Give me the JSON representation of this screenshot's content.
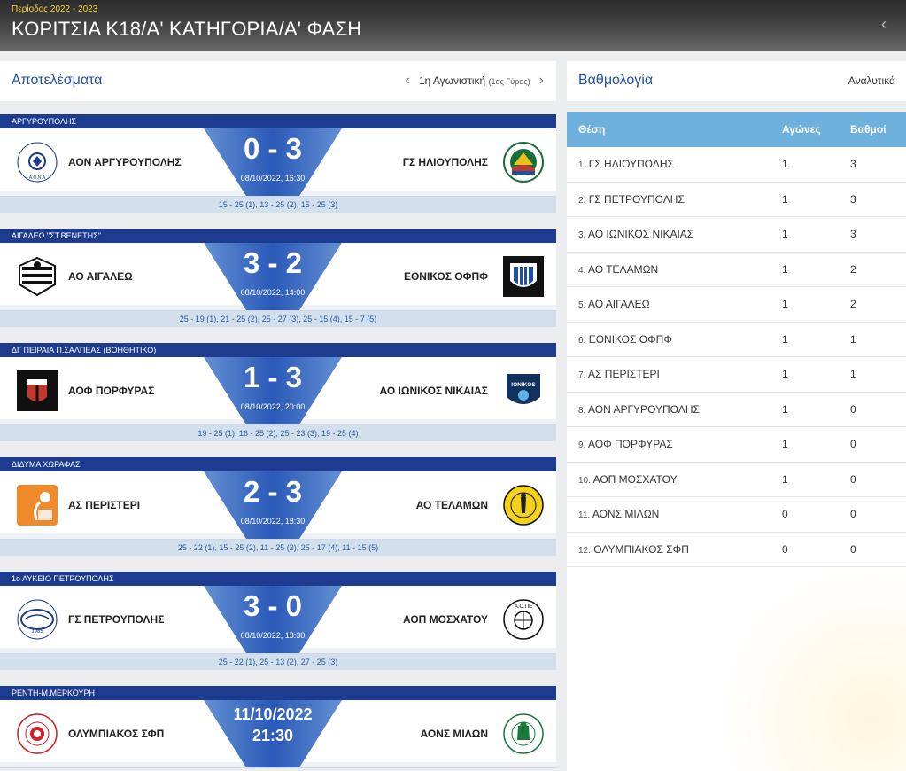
{
  "header": {
    "period": "Περίοδος 2022 - 2023",
    "title": "ΚΟΡΙΤΣΙΑ Κ18/Α' ΚΑΤΗΓΟΡΙΑ/Α' ΦΑΣΗ",
    "back_icon": "chevron-left-icon"
  },
  "results": {
    "title": "Αποτελέσματα",
    "round": "1η Αγωνιστική",
    "round_note": "(1ος Γύρος)",
    "matches": [
      {
        "venue": "ΑΡΓΥΡΟΥΠΟΛΗΣ",
        "home": "ΑΟΝ ΑΡΓΥΡΟΥΠΟΛΗΣ",
        "away": "ΓΣ ΗΛΙΟΥΠΟΛΗΣ",
        "score": "0 - 3",
        "date": "08/10/2022, 16:30",
        "sets": "15 - 25 (1), 13 - 25 (2), 15 - 25 (3)"
      },
      {
        "venue": "ΑΙΓΑΛΕΩ \"ΣΤ.ΒΕΝΕΤΗΣ\"",
        "home": "ΑΟ ΑΙΓΑΛΕΩ",
        "away": "ΕΘΝΙΚΟΣ ΟΦΠΦ",
        "score": "3 - 2",
        "date": "08/10/2022, 14:00",
        "sets": "25 - 19 (1), 21 - 25 (2), 25 - 27 (3), 25 - 15 (4), 15 - 7 (5)"
      },
      {
        "venue": "ΔΓ ΠΕΙΡΑΙΑ Π.ΣΑΛΠΕΑΣ (ΒΟΗΘΗΤΙΚΟ)",
        "home": "ΑΟΦ ΠΟΡΦΥΡΑΣ",
        "away": "ΑΟ ΙΩΝΙΚΟΣ ΝΙΚΑΙΑΣ",
        "score": "1 - 3",
        "date": "08/10/2022, 20:00",
        "sets": "19 - 25 (1), 16 - 25 (2), 25 - 23 (3), 19 - 25 (4)"
      },
      {
        "venue": "ΔΙΔΥΜΑ ΧΩΡΑΦΑΣ",
        "home": "ΑΣ ΠΕΡΙΣΤΕΡΙ",
        "away": "ΑΟ ΤΕΛΑΜΩΝ",
        "score": "2 - 3",
        "date": "08/10/2022, 18:30",
        "sets": "25 - 22 (1), 15 - 25 (2), 11 - 25 (3), 25 - 17 (4), 11 - 15 (5)"
      },
      {
        "venue": "1ο ΛΥΚΕΙΟ ΠΕΤΡΟΥΠΟΛΗΣ",
        "home": "ΓΣ ΠΕΤΡΟΥΠΟΛΗΣ",
        "away": "ΑΟΠ ΜΟΣΧΑΤΟΥ",
        "score": "3 - 0",
        "date": "08/10/2022, 18:30",
        "sets": "25 - 22 (1), 25 - 13 (2), 27 - 25 (3)"
      },
      {
        "venue": "ΡΕΝΤΗ-Μ.ΜΕΡΚΟΥΡΗ",
        "home": "ΟΛΥΜΠΙΑΚΟΣ ΣΦΠ",
        "away": "ΑΟΝΣ ΜΙΛΩΝ",
        "future_date": "11/10/2022",
        "future_time": "21:30"
      }
    ]
  },
  "standings": {
    "title": "Βαθμολογία",
    "link": "Αναλυτικά",
    "cols": [
      "Θέση",
      "Αγώνες",
      "Βαθμοί"
    ],
    "rows": [
      {
        "pos": "1.",
        "team": "ΓΣ ΗΛΙΟΥΠΟΛΗΣ",
        "games": "1",
        "points": "3"
      },
      {
        "pos": "2.",
        "team": "ΓΣ ΠΕΤΡΟΥΠΟΛΗΣ",
        "games": "1",
        "points": "3"
      },
      {
        "pos": "3.",
        "team": "ΑΟ ΙΩΝΙΚΟΣ ΝΙΚΑΙΑΣ",
        "games": "1",
        "points": "3"
      },
      {
        "pos": "4.",
        "team": "ΑΟ ΤΕΛΑΜΩΝ",
        "games": "1",
        "points": "2"
      },
      {
        "pos": "5.",
        "team": "ΑΟ ΑΙΓΑΛΕΩ",
        "games": "1",
        "points": "2"
      },
      {
        "pos": "6.",
        "team": "ΕΘΝΙΚΟΣ ΟΦΠΦ",
        "games": "1",
        "points": "1"
      },
      {
        "pos": "7.",
        "team": "ΑΣ ΠΕΡΙΣΤΕΡΙ",
        "games": "1",
        "points": "1"
      },
      {
        "pos": "8.",
        "team": "ΑΟΝ ΑΡΓΥΡΟΥΠΟΛΗΣ",
        "games": "1",
        "points": "0"
      },
      {
        "pos": "9.",
        "team": "ΑΟΦ ΠΟΡΦΥΡΑΣ",
        "games": "1",
        "points": "0"
      },
      {
        "pos": "10.",
        "team": "ΑΟΠ ΜΟΣΧΑΤΟΥ",
        "games": "1",
        "points": "0"
      },
      {
        "pos": "11.",
        "team": "ΑΟΝΣ ΜΙΛΩΝ",
        "games": "0",
        "points": "0"
      },
      {
        "pos": "12.",
        "team": "ΟΛΥΜΠΙΑΚΟΣ ΣΦΠ",
        "games": "0",
        "points": "0"
      }
    ]
  },
  "colors": {
    "brand_blue": "#1e3c8f",
    "link_blue": "#1f4ea8",
    "table_head": "#6fb1de",
    "sets_bg": "#d2dfec",
    "period_yellow": "#f3d432"
  }
}
